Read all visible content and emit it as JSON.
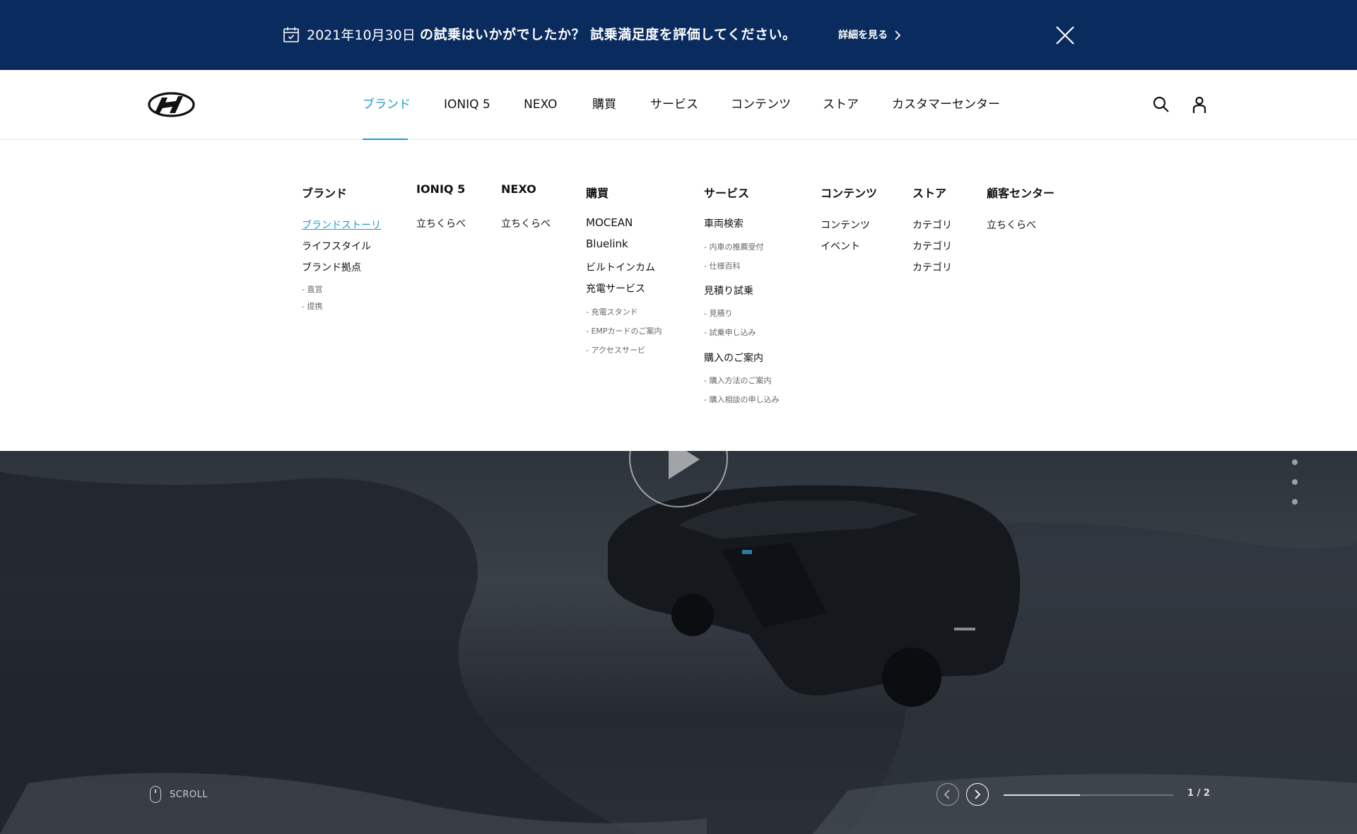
{
  "banner": {
    "date": "2021年10月30日",
    "message": "の試乗はいかがでしたか？ 試乗満足度を評価してください。",
    "detail_label": "詳細を見る",
    "bg_color": "#0a2b5e"
  },
  "header": {
    "nav": [
      "ブランド",
      "IONIQ 5",
      "NEXO",
      "購買",
      "サービス",
      "コンテンツ",
      "ストア",
      "カスタマーセンター"
    ],
    "active_index": 0,
    "accent_color": "#1a9ed0"
  },
  "mega_menu": {
    "brand": {
      "title": "ブランド",
      "items": [
        "ブランドストーリ",
        "ライフスタイル",
        "ブランド拠点"
      ],
      "subs": [
        "- 直営",
        "- 提携"
      ]
    },
    "ioniq5": {
      "title": "IONIQ 5",
      "items": [
        "立ちくらべ"
      ]
    },
    "nexo": {
      "title": "NEXO",
      "items": [
        "立ちくらべ"
      ]
    },
    "purchase": {
      "title": "購買",
      "items": [
        "MOCEAN",
        "Bluelink",
        "ビルトインカム",
        "充電サービス"
      ],
      "subs": [
        "- 充電スタンド",
        "- EMPカードのご案内",
        "- アクセスサービ"
      ]
    },
    "service": {
      "title": "サービス",
      "group1": "車両検索",
      "group1_subs": [
        "- 内車の推薦受付",
        "- 仕様百科"
      ],
      "group2": "見積り試乗",
      "group2_subs": [
        "- 見積り",
        "- 試乗申し込み"
      ],
      "group3": "購入のご案内",
      "group3_subs": [
        "- 購入方法のご案内",
        "- 購入相談の申し込み"
      ]
    },
    "contents": {
      "title": "コンテンツ",
      "items": [
        "コンテンツ",
        "イベント"
      ]
    },
    "store": {
      "title": "ストア",
      "items": [
        "カテゴリ",
        "カテゴリ",
        "カテゴリ"
      ]
    },
    "customer": {
      "title": "顧客センター",
      "items": [
        "立ちくらべ"
      ]
    }
  },
  "hero": {
    "scroll_label": "SCROLL",
    "pager": "1 / 2",
    "progress": 0.45
  }
}
